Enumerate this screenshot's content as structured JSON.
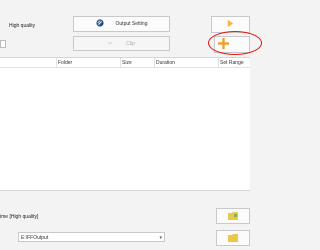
{
  "profile": {
    "quality_label": "High quality"
  },
  "buttons": {
    "output_setting": "Output Setting",
    "clip": "Clip"
  },
  "table": {
    "columns": [
      "Folder",
      "Size",
      "Duration",
      "Set Range"
    ]
  },
  "output": {
    "name_label": "ime [High quality]",
    "folder_value": "E:\\FFOutput"
  },
  "colors": {
    "highlight": "#e01515",
    "accent_orange": "#f39a1e",
    "folder_yellow": "#e9c84a"
  },
  "icons": {
    "output_setting": "ffmpeg-logo-icon",
    "side_button": "arrow-icon",
    "add_button": "plus-icon",
    "folder_button": "folder-icon",
    "dropdown": "chevron-down-icon"
  }
}
